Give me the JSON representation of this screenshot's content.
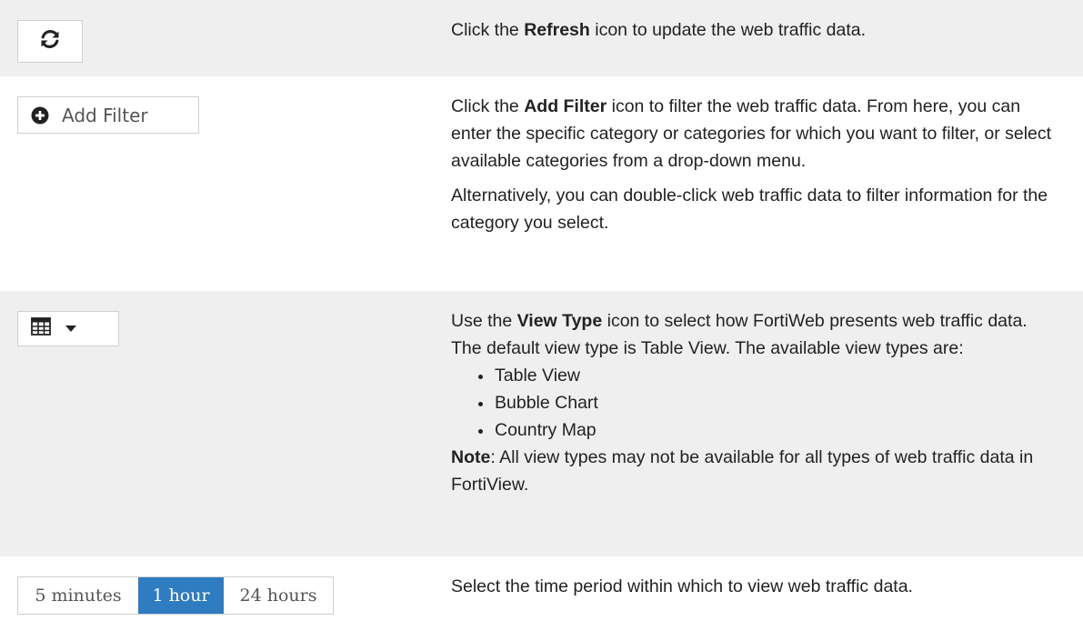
{
  "rows": [
    {
      "control": {
        "icon": "refresh-icon"
      },
      "description": {
        "before": "Click the ",
        "bold": "Refresh",
        "after": " icon to update the web traffic data."
      }
    },
    {
      "control": {
        "icon": "plus-circle-icon",
        "label": "Add Filter"
      },
      "description": {
        "before": "Click the ",
        "bold": "Add Filter",
        "after": " icon to filter the web traffic data. From here, you can enter the specific category or categories for which you want to filter, or select available categories from a drop-down menu.",
        "para2": "Alternatively, you can double-click web traffic data to filter information for the category you select."
      }
    },
    {
      "control": {
        "icon": "table-icon",
        "caret": "caret-down-icon"
      },
      "description": {
        "before": "Use the ",
        "bold": "View Type",
        "after": " icon to select how FortiWeb presents web traffic data. The default view type is Table View. The available view types are:",
        "items": [
          "Table View",
          "Bubble Chart",
          "Country Map"
        ],
        "note_label": "Note",
        "note_text": ": All view types may not be available for all types of web traffic data in FortiView."
      }
    },
    {
      "control": {
        "options": [
          "5 minutes",
          "1 hour",
          "24 hours"
        ],
        "selected": "1 hour",
        "selected_color": "#2f7cc0"
      },
      "description": {
        "text": "Select the time period within which to view web traffic data."
      }
    }
  ],
  "colors": {
    "row_shaded": "#efefef",
    "row_plain": "#ffffff",
    "accent": "#2f7cc0"
  }
}
